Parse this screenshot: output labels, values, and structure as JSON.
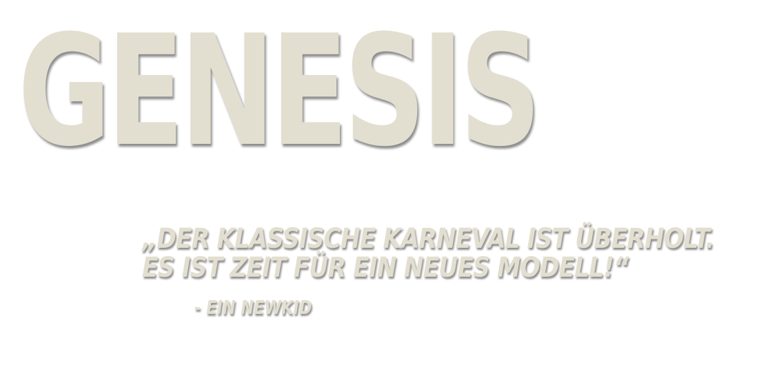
{
  "title": "GENESIS",
  "quote": {
    "line1": "„DER KLASSISCHE KARNEVAL IST ÜBERHOLT.",
    "line2": "ES IST ZEIT FÜR EIN NEUES MODELL!“"
  },
  "attribution": "- EIN NEWKID",
  "colors": {
    "text": "#e3dfd0",
    "background": "#ffffff"
  }
}
